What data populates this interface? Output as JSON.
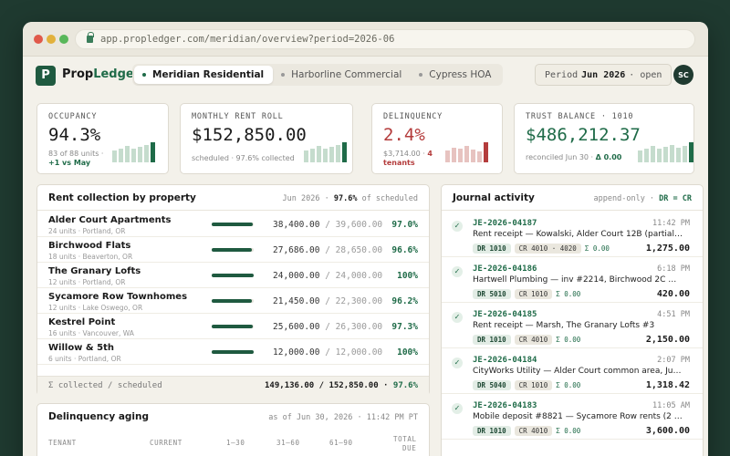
{
  "browser": {
    "url": "app.propledger.com/meridian/overview?period=2026-06"
  },
  "brand": {
    "mark": "P",
    "name_a": "Prop",
    "name_b": "Ledger"
  },
  "tabs": [
    "Meridian Residential",
    "Harborline Commercial",
    "Cypress HOA"
  ],
  "period": {
    "label": "Period",
    "value": "Jun 2026",
    "status": "· open"
  },
  "user": {
    "initials": "SC"
  },
  "kpis": {
    "occupancy": {
      "label": "OCCUPANCY",
      "value": "94.3%",
      "sub": "83 of 88 units ·",
      "delta": "+1 vs May",
      "level_pct": 94.3
    },
    "rent_roll": {
      "label": "MONTHLY RENT ROLL",
      "value": "$152,850.00",
      "sub": "scheduled · 97.6% collected",
      "level_pct": 97.6
    },
    "delinquency": {
      "label": "DELINQUENCY",
      "value": "2.4%",
      "sub": "$3,714.00 ·",
      "count": "4",
      "sub2": "tenants"
    },
    "trust": {
      "label": "TRUST BALANCE · 1010",
      "value": "$486,212.37",
      "sub": "reconciled Jun 30 ·",
      "delta": "Δ 0.00"
    }
  },
  "colors": {
    "accent": "#1f6b48",
    "danger": "#b43c3c",
    "bar_light": "#c5dccd"
  },
  "rent": {
    "title": "Rent collection by property",
    "meta_pre": "Jun 2026 ·",
    "meta_pct": "97.6%",
    "meta_post": "of scheduled",
    "rows": [
      {
        "name": "Alder Court Apartments",
        "sub": "24 units · Portland, OR",
        "collected": "38,400.00",
        "scheduled": "39,600.00",
        "pct": "97.0%",
        "fill": 97.0
      },
      {
        "name": "Birchwood Flats",
        "sub": "18 units · Beaverton, OR",
        "collected": "27,686.00",
        "scheduled": "28,650.00",
        "pct": "96.6%",
        "fill": 96.6
      },
      {
        "name": "The Granary Lofts",
        "sub": "12 units · Portland, OR",
        "collected": "24,000.00",
        "scheduled": "24,000.00",
        "pct": "100%",
        "fill": 100
      },
      {
        "name": "Sycamore Row Townhomes",
        "sub": "12 units · Lake Oswego, OR",
        "collected": "21,450.00",
        "scheduled": "22,300.00",
        "pct": "96.2%",
        "fill": 96.2
      },
      {
        "name": "Kestrel Point",
        "sub": "16 units · Vancouver, WA",
        "collected": "25,600.00",
        "scheduled": "26,300.00",
        "pct": "97.3%",
        "fill": 97.3
      },
      {
        "name": "Willow & 5th",
        "sub": "6 units · Portland, OR",
        "collected": "12,000.00",
        "scheduled": "12,000.00",
        "pct": "100%",
        "fill": 100
      }
    ],
    "footer_label": "Σ collected / scheduled",
    "footer_total": "149,136.00 / 152,850.00 ·",
    "footer_pct": "97.6%"
  },
  "aging": {
    "title": "Delinquency aging",
    "meta": "as of Jun 30, 2026 · 11:42 PM PT",
    "headers": [
      "TENANT",
      "CURRENT",
      "1–30",
      "31–60",
      "61–90",
      "TOTAL",
      "DUE"
    ]
  },
  "journal": {
    "title": "Journal activity",
    "meta": "append-only ·",
    "meta_b": "DR = CR",
    "entries": [
      {
        "id": "JE-2026-04187",
        "time": "11:42 PM",
        "desc": "Rent receipt — Kowalski, Alder Court 12B (partial + late fee)",
        "dr": "DR 1010",
        "cr": "CR 4010 · 4020",
        "sigma": "Σ 0.00",
        "amount": "1,275.00"
      },
      {
        "id": "JE-2026-04186",
        "time": "6:18 PM",
        "desc": "Hartwell Plumbing — inv #2214, Birchwood 2C water heater",
        "dr": "DR 5010",
        "cr": "CR 1010",
        "sigma": "Σ 0.00",
        "amount": "420.00"
      },
      {
        "id": "JE-2026-04185",
        "time": "4:51 PM",
        "desc": "Rent receipt — Marsh, The Granary Lofts #3",
        "dr": "DR 1010",
        "cr": "CR 4010",
        "sigma": "Σ 0.00",
        "amount": "2,150.00"
      },
      {
        "id": "JE-2026-04184",
        "time": "2:07 PM",
        "desc": "CityWorks Utility — Alder Court common area, June",
        "dr": "DR 5040",
        "cr": "CR 1010",
        "sigma": "Σ 0.00",
        "amount": "1,318.42"
      },
      {
        "id": "JE-2026-04183",
        "time": "11:05 AM",
        "desc": "Mobile deposit #8821 — Sycamore Row rents (2 units)",
        "dr": "DR 1010",
        "cr": "CR 4010",
        "sigma": "Σ 0.00",
        "amount": "3,600.00"
      }
    ]
  }
}
